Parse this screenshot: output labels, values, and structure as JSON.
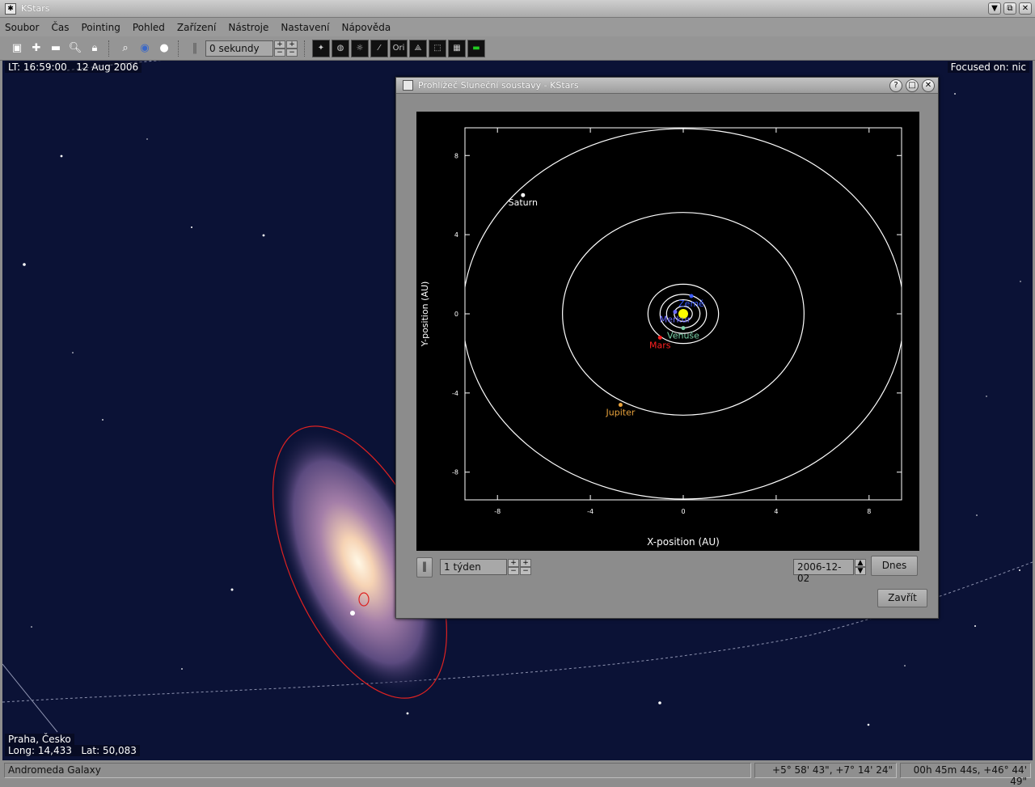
{
  "window": {
    "title": "KStars",
    "icon": "kstars-icon",
    "controls": [
      "▼",
      "⧉",
      "✕"
    ]
  },
  "menu": [
    "Soubor",
    "Čas",
    "Pointing",
    "Pohled",
    "Zařízení",
    "Nástroje",
    "Nastavení",
    "Nápověda"
  ],
  "toolbar": {
    "left_icons": [
      "center-icon",
      "zoom-in-icon",
      "zoom-out-icon",
      "search-icon",
      "lock-icon",
      "find-icon",
      "globe-icon",
      "sphere-icon"
    ],
    "time_step": "0 sekundy",
    "view_icons": [
      "stars-icon",
      "deep-sky-icon",
      "solar-system-icon",
      "milky-way-icon",
      "constellation-names-icon",
      "constellation-lines-icon",
      "boundaries-icon",
      "grid-icon",
      "horizon-icon"
    ]
  },
  "sky": {
    "time": "LT: 16:59:00",
    "date": "12 Aug 2006",
    "focus": "Focused on: nic",
    "location": "Praha, Česko",
    "long": "Long: 14,433",
    "lat": "Lat: 50,083"
  },
  "status": {
    "object": "Andromeda Galaxy",
    "altaz": "+5° 58' 43\",  +7° 14' 24\"",
    "radec": "00h 45m 44s,  +46° 44' 49\""
  },
  "dialog": {
    "title": "Prohlížeč Sluneční soustavy - KStars",
    "time_step": "1 týden",
    "date": "2006-12-02",
    "today_button": "Dnes",
    "close_button": "Zavřít"
  },
  "chart_data": {
    "type": "scatter",
    "xlabel": "X-position (AU)",
    "ylabel": "Y-position (AU)",
    "xlim": [
      -9.4,
      9.4
    ],
    "ylim": [
      -9.4,
      9.4
    ],
    "xticks": [
      -8,
      -4,
      0,
      4,
      8
    ],
    "yticks": [
      8,
      4,
      0,
      -4,
      -8
    ],
    "sun": {
      "x": 0,
      "y": 0
    },
    "orbits": [
      {
        "name": "Mercury",
        "a": 0.39
      },
      {
        "name": "Venuše",
        "a": 0.72
      },
      {
        "name": "Earth",
        "a": 1.0
      },
      {
        "name": "Mars",
        "a": 1.52
      },
      {
        "name": "Jupiter",
        "a": 5.2
      },
      {
        "name": "Saturn",
        "a": 9.5
      }
    ],
    "planets": [
      {
        "name": "Merkur",
        "x": -0.35,
        "y": 0.1,
        "color": "#6b6bff"
      },
      {
        "name": "Venuše",
        "x": 0.0,
        "y": -0.72,
        "color": "#7ad1a8"
      },
      {
        "name": "Země",
        "x": 0.35,
        "y": 0.9,
        "color": "#3b5bff"
      },
      {
        "name": "Mars",
        "x": -1.0,
        "y": -1.2,
        "color": "#ff2020"
      },
      {
        "name": "Jupiter",
        "x": -2.7,
        "y": -4.6,
        "color": "#e8a23c"
      },
      {
        "name": "Saturn",
        "x": -6.9,
        "y": 6.0,
        "color": "#ffffff"
      }
    ]
  }
}
